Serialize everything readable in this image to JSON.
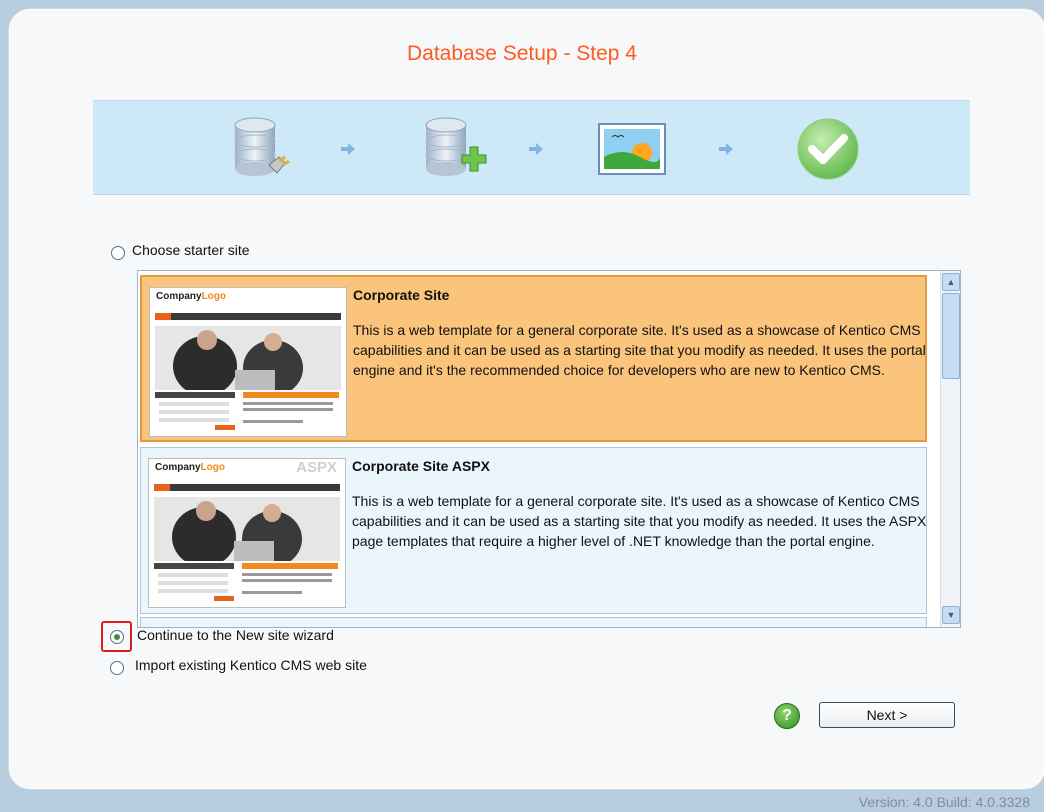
{
  "page": {
    "title": "Database Setup - Step 4",
    "version": "Version: 4.0 Build: 4.0.3328"
  },
  "steps": {
    "icons": [
      "database-connect-icon",
      "database-add-icon",
      "site-image-icon",
      "checkmark-icon"
    ],
    "arrow_icon": "arrow-right-icon"
  },
  "options": {
    "starter": {
      "label": "Choose starter site",
      "checked": false
    },
    "wizard": {
      "label": "Continue to the New site wizard",
      "checked": true
    },
    "import": {
      "label": "Import existing Kentico CMS web site",
      "checked": false
    }
  },
  "templates": [
    {
      "title": "Corporate Site",
      "description": "This is a web template for a general corporate site. It's used as a showcase of Kentico CMS capabilities and it can be used as a starting site that you modify as needed. It uses the portal engine and it's the recommended choice for developers who are new to Kentico CMS.",
      "thumb_logo_a": "Company",
      "thumb_logo_b": "Logo",
      "thumb_badge": "",
      "selected": true
    },
    {
      "title": "Corporate Site ASPX",
      "description": "This is a web template for a general corporate site. It's used as a showcase of Kentico CMS capabilities and it can be used as a starting site that you modify as needed. It uses the ASPX page templates that require a higher level of .NET knowledge than the portal engine.",
      "thumb_logo_a": "Company",
      "thumb_logo_b": "Logo",
      "thumb_badge": "ASPX",
      "selected": false
    }
  ],
  "buttons": {
    "help": "?",
    "next": "Next >"
  },
  "colors": {
    "title": "#ff5a1f",
    "selected_item": "#fbc47c",
    "highlight": "#e01b1b"
  }
}
